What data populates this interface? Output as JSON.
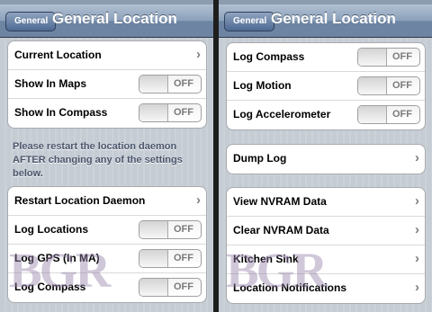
{
  "left": {
    "back_label": "General",
    "title": "General Location",
    "group1": [
      {
        "label": "Current Location",
        "accessory": "chevron"
      },
      {
        "label": "Show In Maps",
        "accessory": "toggle",
        "state": "OFF"
      },
      {
        "label": "Show In Compass",
        "accessory": "toggle",
        "state": "OFF"
      }
    ],
    "note": "Please restart the location daemon AFTER changing any of the settings below.",
    "group2": [
      {
        "label": "Restart Location Daemon",
        "accessory": "chevron"
      },
      {
        "label": "Log Locations",
        "accessory": "toggle",
        "state": "OFF"
      },
      {
        "label": "Log GPS (In MA)",
        "accessory": "toggle",
        "state": "OFF"
      },
      {
        "label": "Log Compass",
        "accessory": "toggle",
        "state": "OFF"
      }
    ]
  },
  "right": {
    "back_label": "General",
    "title": "General Location",
    "group1": [
      {
        "label": "Log Compass",
        "accessory": "toggle",
        "state": "OFF"
      },
      {
        "label": "Log Motion",
        "accessory": "toggle",
        "state": "OFF"
      },
      {
        "label": "Log Accelerometer",
        "accessory": "toggle",
        "state": "OFF"
      }
    ],
    "group2": [
      {
        "label": "Dump Log",
        "accessory": "chevron"
      }
    ],
    "group3": [
      {
        "label": "View NVRAM Data",
        "accessory": "chevron"
      },
      {
        "label": "Clear NVRAM Data",
        "accessory": "chevron"
      },
      {
        "label": "Kitchen Sink",
        "accessory": "chevron"
      },
      {
        "label": "Location Notifications",
        "accessory": "chevron"
      }
    ]
  },
  "watermark": "BGR",
  "icons": {
    "chevron": "chevron-right-icon"
  },
  "colors": {
    "navbar": "#6d84a2",
    "background": "#c5ccd4",
    "note_text": "#4c566c"
  }
}
